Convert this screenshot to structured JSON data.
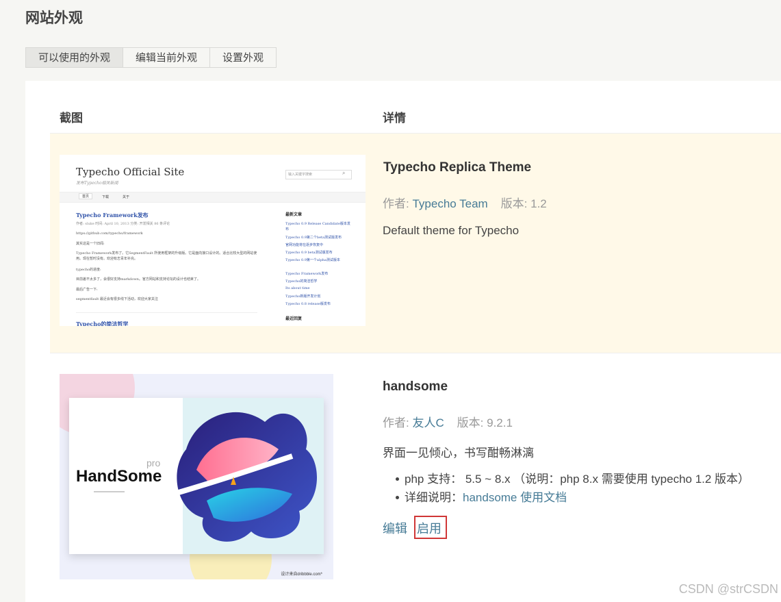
{
  "page": {
    "title": "网站外观"
  },
  "tabs": [
    {
      "label": "可以使用的外观",
      "active": true
    },
    {
      "label": "编辑当前外观",
      "active": false
    },
    {
      "label": "设置外观",
      "active": false
    }
  ],
  "table": {
    "headers": [
      "截图",
      "详情"
    ]
  },
  "themes": [
    {
      "name": "Typecho Replica Theme",
      "author_label": "作者:",
      "author": "Typecho Team",
      "version_label": "版本:",
      "version": "1.2",
      "description": "Default theme for Typecho",
      "current": true,
      "screenshot": {
        "site_title": "Typecho Official Site",
        "site_subtitle": "发布Typecho相关新闻",
        "search_placeholder": "输入关键字搜索",
        "nav": [
          "首页",
          "下载",
          "关于"
        ],
        "post_title": "Typecho Framework发布",
        "post_meta": "作者: sluke   时间: April 10, 2013   分类: 开发相关   86 条评论",
        "post_lines": [
          "https://github.com/typecho/framework",
          "其实这是一个旧闻:",
          "Typecho Framework发布了。它SegmentFault 所使用框架的升级版。它是面向接口设计的。适合比较大型的网站使用。现在暂时没有。欢迎有志青年补充。",
          "typecho的进度:",
          "目前差不太多了，会很好支持markdown。官方网站和支持论坛的设计也结束了。",
          "最后广告一下:",
          "segmentfault 最近会有很多线下活动，欢迎大家关注"
        ],
        "post2_title": "Typecho的简洁哲学",
        "sidebar_heading": "最新文章",
        "sidebar_items": [
          "Typecho 0.9 Release Candidate版本发布",
          "Typecho 0.9第二个beta测试版发布",
          "官网功能将在逐步恢复中",
          "Typecho 0.9 beta测试版发布",
          "Typecho 0.9第一个alpha测试版本",
          "Typecho Framework发布",
          "Typecho的简洁哲学",
          "Its about time",
          "Typecho新版开发计划",
          "Typecho 0.8 release版发布"
        ],
        "sidebar_heading2": "最近回复"
      }
    },
    {
      "name": "handsome",
      "author_label": "作者:",
      "author": "友人C",
      "version_label": "版本:",
      "version": "9.2.1",
      "description": "界面一见倾心，书写酣畅淋漓",
      "current": false,
      "screenshot": {
        "brand": "HandSome",
        "brand_tag": "pro",
        "credit": "设计来自dribbble.com*"
      },
      "details": [
        {
          "label": "php 支持：",
          "value": " 5.5 ~ 8.x （说明：php 8.x 需要使用 typecho 1.2 版本）"
        },
        {
          "label": "详细说明：",
          "link": "handsome 使用文档"
        }
      ],
      "actions": {
        "edit": "编辑",
        "activate": "启用"
      }
    }
  ],
  "watermark": "CSDN @strCSDN",
  "colors": {
    "link": "#467b96",
    "current_row_bg": "#fff9e8",
    "highlight_border": "#d03636"
  }
}
